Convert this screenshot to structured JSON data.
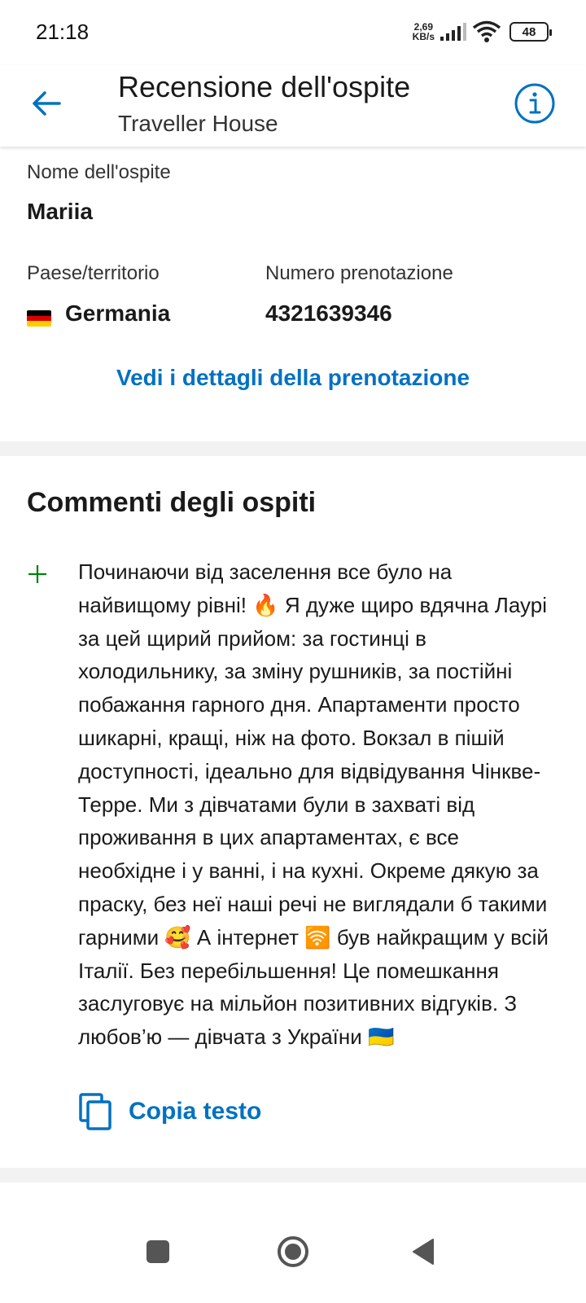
{
  "status_bar": {
    "time": "21:18",
    "net_speed_value": "2,69",
    "net_speed_unit": "KB/s",
    "battery": "48"
  },
  "app_bar": {
    "title": "Recensione dell'ospite",
    "subtitle": "Traveller House"
  },
  "guest": {
    "name_label": "Nome dell'ospite",
    "name_value": "Mariia",
    "country_label": "Paese/territorio",
    "country_value": "Germania",
    "booking_label": "Numero prenotazione",
    "booking_value": "4321639346",
    "details_link": "Vedi i dettagli della prenotazione"
  },
  "comments": {
    "title": "Commenti degli ospiti",
    "positive_text": "Починаючи від заселення все було на найвищому рівні! 🔥 Я дуже щиро вдячна Лаурі за цей щирий прийом: за гостинці в холодильнику, за зміну рушників, за постійні побажання гарного дня. Апартаменти просто шикарні, кращі, ніж на фото. Вокзал в пішій доступності, ідеально для відвідування Чінкве-Терре. Ми з дівчатами були в захваті від проживання в цих апартаментах, є все необхідне і у ванні, і на кухні. Окреме дякую за праску, без неї наші речі не виглядали б такими гарними 🥰 А інтернет 🛜 був найкращим у всій Італії. Без перебільшення! Це помешкання заслуговує на мільйон позитивних відгуків. З любов’ю — дівчата з України 🇺🇦",
    "copy_label": "Copia testo"
  },
  "colors": {
    "accent": "#0071c2",
    "positive": "#008009",
    "divider": "#f2f2f2"
  },
  "icons": {
    "back": "arrow-left-icon",
    "info": "info-icon",
    "positive": "plus-icon",
    "copy": "copy-icon",
    "nav_recents": "square-icon",
    "nav_home": "circle-icon",
    "nav_back": "triangle-icon"
  }
}
